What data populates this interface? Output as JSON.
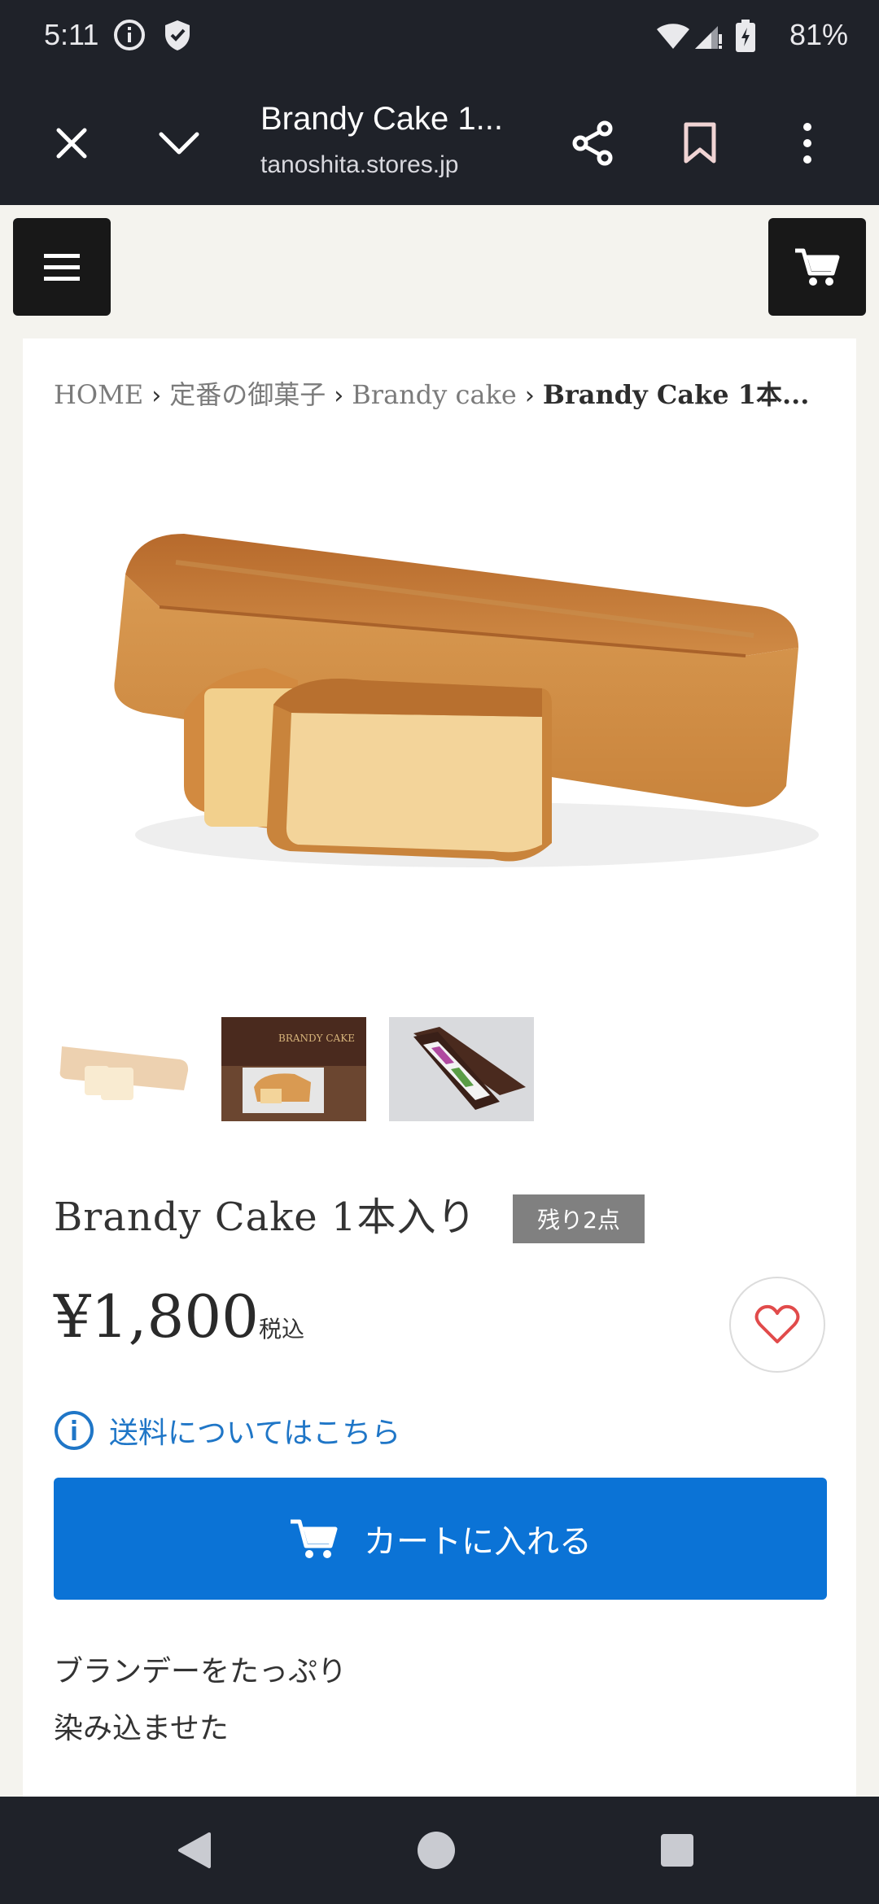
{
  "status": {
    "time": "5:11",
    "battery": "81%"
  },
  "browser": {
    "title": "Brandy Cake 1...",
    "url": "tanoshita.stores.jp"
  },
  "breadcrumb": {
    "items": [
      "HOME",
      "定番の御菓子",
      "Brandy cake"
    ],
    "current": "Brandy Cake 1本..."
  },
  "product": {
    "title": "Brandy Cake 1本入り",
    "stock_badge": "残り2点",
    "price": "¥1,800",
    "tax_label": "税込",
    "shipping_link": "送料についてはこちら",
    "cart_button": "カートに入れる",
    "description": [
      "ブランデーをたっぷり",
      "染み込ませた"
    ]
  },
  "colors": {
    "accent_blue": "#0b73d6",
    "link_blue": "#1f76c7",
    "badge_gray": "#808080",
    "heart_red": "#e14b4b"
  }
}
